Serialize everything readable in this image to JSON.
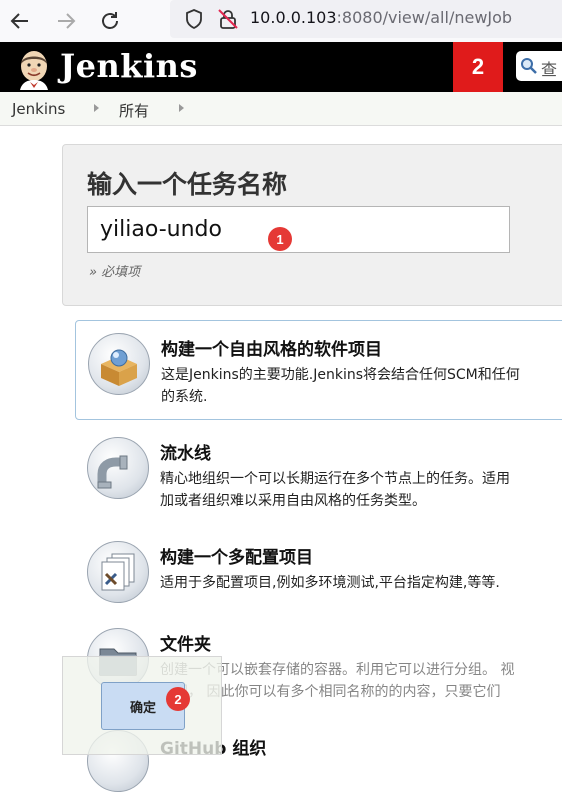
{
  "browser": {
    "url_host": "10.0.0.103",
    "url_rest": ":8080/view/all/newJob"
  },
  "header": {
    "title": "Jenkins",
    "notification_count": "2",
    "search_placeholder": "查"
  },
  "breadcrumb": {
    "items": [
      "Jenkins",
      "所有"
    ]
  },
  "form": {
    "title": "输入一个任务名称",
    "name_value": "yiliao-undo",
    "required_note": "» 必填项",
    "marker_1": "1",
    "marker_2": "2"
  },
  "items": [
    {
      "name": "构建一个自由风格的软件项目",
      "desc": "这是Jenkins的主要功能.Jenkins将会结合任何SCM和任何\n的系统."
    },
    {
      "name": "流水线",
      "desc": "精心地组织一个可以长期运行在多个节点上的任务。适用\n加或者组织难以采用自由风格的任务类型。"
    },
    {
      "name": "构建一个多配置项目",
      "desc": "适用于多配置项目,例如多环境测试,平台指定构建,等等."
    },
    {
      "name": "文件夹",
      "desc": "创建一个可以嵌套存储的容器。利用它可以进行分组。 视\n空间， 因此你可以有多个相同名称的的内容，只要它们"
    },
    {
      "name": "GitHub 组织",
      "desc": ""
    }
  ],
  "ok_button_label": "确定",
  "colors": {
    "header_bg": "#000000",
    "badge_red": "#e01b1b",
    "selected_border": "#a3c4de",
    "ok_button_bg": "#c9dcf3"
  }
}
